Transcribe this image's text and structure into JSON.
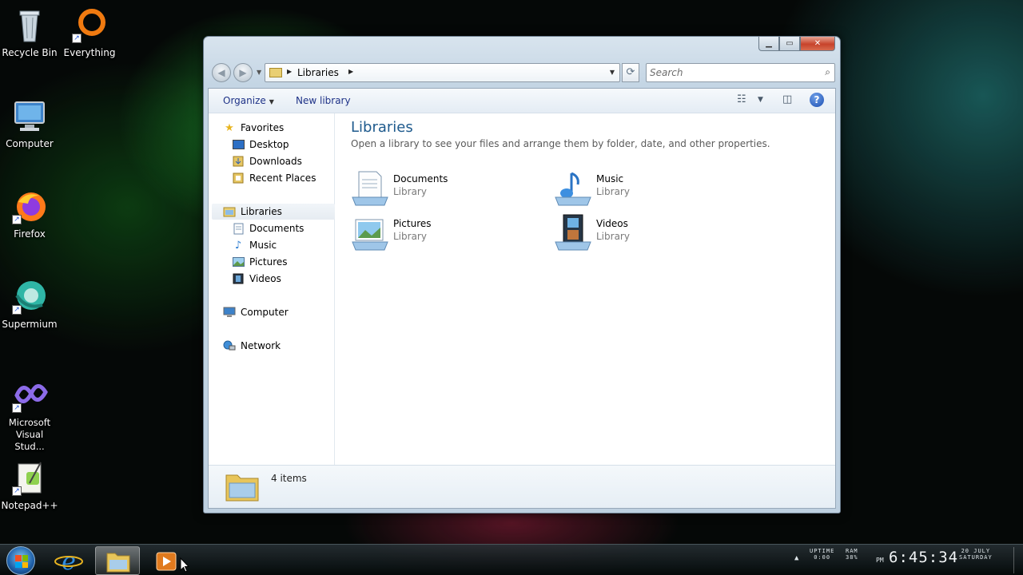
{
  "desktop": {
    "icons": [
      {
        "label": "Recycle Bin"
      },
      {
        "label": "Everything"
      },
      {
        "label": "Computer"
      },
      {
        "label": "Firefox"
      },
      {
        "label": "Supermium"
      },
      {
        "label": "Microsoft Visual Stud..."
      },
      {
        "label": "Notepad++"
      }
    ]
  },
  "window": {
    "address": {
      "crumb": "Libraries"
    },
    "search": {
      "placeholder": "Search"
    },
    "toolbar": {
      "organize": "Organize",
      "new_library": "New library"
    },
    "nav": {
      "favorites": "Favorites",
      "desktop": "Desktop",
      "downloads": "Downloads",
      "recent_places": "Recent Places",
      "libraries": "Libraries",
      "documents": "Documents",
      "music": "Music",
      "pictures": "Pictures",
      "videos": "Videos",
      "computer": "Computer",
      "network": "Network"
    },
    "content": {
      "title": "Libraries",
      "description": "Open a library to see your files and arrange them by folder, date, and other properties.",
      "libraries": [
        {
          "name": "Documents",
          "type": "Library"
        },
        {
          "name": "Music",
          "type": "Library"
        },
        {
          "name": "Pictures",
          "type": "Library"
        },
        {
          "name": "Videos",
          "type": "Library"
        }
      ]
    },
    "details": {
      "count": "4 items"
    }
  },
  "taskbar": {
    "uptime_label": "UPTIME",
    "uptime_value": "0:00",
    "ram_label": "RAM",
    "ram_value": "38%",
    "ampm": "PM",
    "time": "6:45:34",
    "date": "20 JULY",
    "day": "SATURDAY"
  },
  "colors": {
    "accent": "#1e5a8d",
    "link": "#1e3287",
    "close_red": "#c7432a"
  }
}
